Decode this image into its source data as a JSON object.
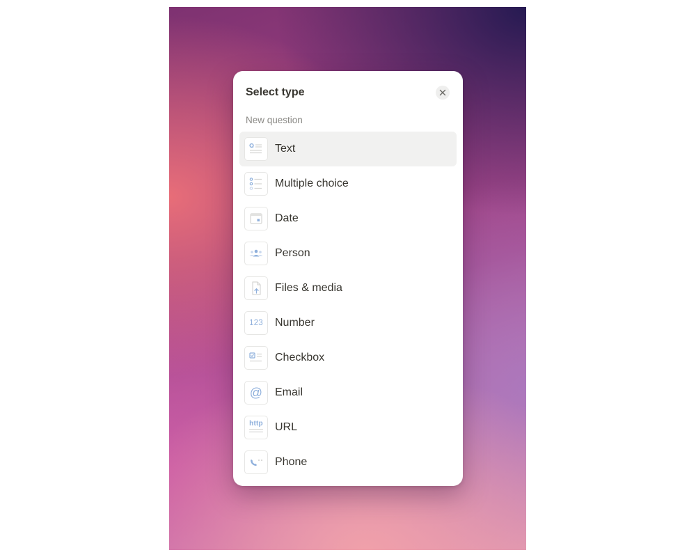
{
  "modal": {
    "title": "Select type",
    "close_icon": "close-icon",
    "section_label": "New question",
    "items": [
      {
        "label": "Text",
        "icon": "text-field-icon",
        "active": true
      },
      {
        "label": "Multiple choice",
        "icon": "multiple-choice-icon",
        "active": false
      },
      {
        "label": "Date",
        "icon": "calendar-icon",
        "active": false
      },
      {
        "label": "Person",
        "icon": "people-icon",
        "active": false
      },
      {
        "label": "Files & media",
        "icon": "file-upload-icon",
        "active": false
      },
      {
        "label": "Number",
        "icon": "number-icon",
        "icon_text": "123",
        "active": false
      },
      {
        "label": "Checkbox",
        "icon": "checkbox-icon",
        "active": false
      },
      {
        "label": "Email",
        "icon": "at-sign-icon",
        "icon_text": "@",
        "active": false
      },
      {
        "label": "URL",
        "icon": "url-icon",
        "icon_text": "http",
        "active": false
      },
      {
        "label": "Phone",
        "icon": "phone-icon",
        "active": false
      }
    ]
  },
  "colors": {
    "icon_accent": "#8fb0dc",
    "icon_line": "#d6d6d4",
    "text_primary": "#37352f",
    "text_secondary": "#8a8985",
    "active_bg": "#f1f1f0"
  }
}
